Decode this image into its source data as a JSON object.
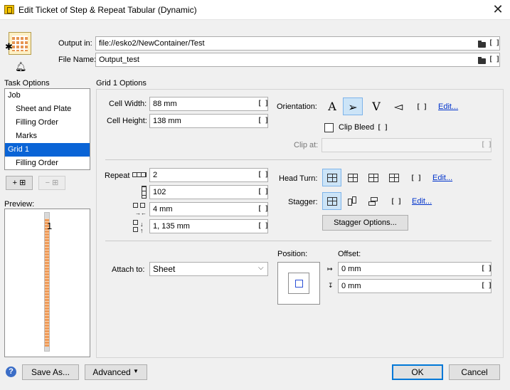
{
  "window": {
    "title": "Edit Ticket of Step & Repeat Tabular (Dynamic)"
  },
  "output": {
    "output_in_label": "Output in:",
    "output_in_value": "file://esko2/NewContainer/Test",
    "file_name_label": "File Name:",
    "file_name_value": "Output_test"
  },
  "task_options": {
    "label": "Task Options",
    "items": [
      {
        "label": "Job"
      },
      {
        "label": "Sheet and Plate"
      },
      {
        "label": "Filling Order"
      },
      {
        "label": "Marks"
      },
      {
        "label": "Grid 1"
      },
      {
        "label": "Filling Order"
      }
    ],
    "add_label": "+ ⊞",
    "remove_label": "− ⊞"
  },
  "preview": {
    "label": "Preview:",
    "strip_number": "1"
  },
  "grid": {
    "section_title": "Grid 1 Options",
    "cell_width_label": "Cell Width:",
    "cell_width_value": "88 mm",
    "cell_height_label": "Cell Height:",
    "cell_height_value": "138 mm",
    "orientation_label": "Orientation:",
    "orientation_glyphs": [
      "A",
      "➢",
      "V",
      "◅"
    ],
    "orientation_edit": "Edit...",
    "clip_bleed_label": "Clip Bleed",
    "clip_at_label": "Clip at:",
    "clip_at_value": "",
    "repeat_label": "Repeat",
    "repeat_across": "2",
    "repeat_down": "102",
    "gap_horizontal": "4 mm",
    "gap_vertical": "1, 135 mm",
    "head_turn_label": "Head Turn:",
    "head_turn_edit": "Edit...",
    "stagger_label": "Stagger:",
    "stagger_edit": "Edit...",
    "stagger_options_button": "Stagger Options...",
    "attach_to_label": "Attach to:",
    "attach_to_value": "Sheet",
    "position_label": "Position:",
    "offset_label": "Offset:",
    "offset_x": "0 mm",
    "offset_y": "0 mm",
    "bracket_glyph": "[ ]"
  },
  "footer": {
    "save_as": "Save As...",
    "advanced": "Advanced",
    "ok": "OK",
    "cancel": "Cancel",
    "help": "?"
  },
  "colors": {
    "selection": "#0a64d6",
    "strip": "#ef9a58"
  }
}
